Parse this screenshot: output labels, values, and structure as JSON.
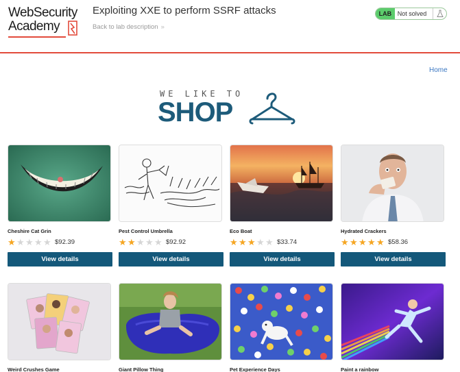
{
  "header": {
    "logo_line1": "WebSecurity",
    "logo_line2": "Academy",
    "lab_title": "Exploiting XXE to perform SSRF attacks",
    "back_link": "Back to lab description",
    "status_tag": "LAB",
    "status_text": "Not solved"
  },
  "nav": {
    "home": "Home"
  },
  "banner": {
    "tagline": "WE LIKE TO",
    "title": "SHOP"
  },
  "colors": {
    "accent": "#e24a3b",
    "button": "#14587a",
    "star": "#f5a623",
    "lab_badge": "#5ccc6c"
  },
  "products": [
    {
      "name": "Cheshire Cat Grin",
      "rating": 1,
      "price": "$92.39",
      "button": "View details"
    },
    {
      "name": "Pest Control Umbrella",
      "rating": 2,
      "price": "$92.92",
      "button": "View details"
    },
    {
      "name": "Eco Boat",
      "rating": 3,
      "price": "$33.74",
      "button": "View details"
    },
    {
      "name": "Hydrated Crackers",
      "rating": 5,
      "price": "$58.36",
      "button": "View details"
    },
    {
      "name": "Weird Crushes Game"
    },
    {
      "name": "Giant Pillow Thing"
    },
    {
      "name": "Pet Experience Days"
    },
    {
      "name": "Paint a rainbow"
    }
  ]
}
